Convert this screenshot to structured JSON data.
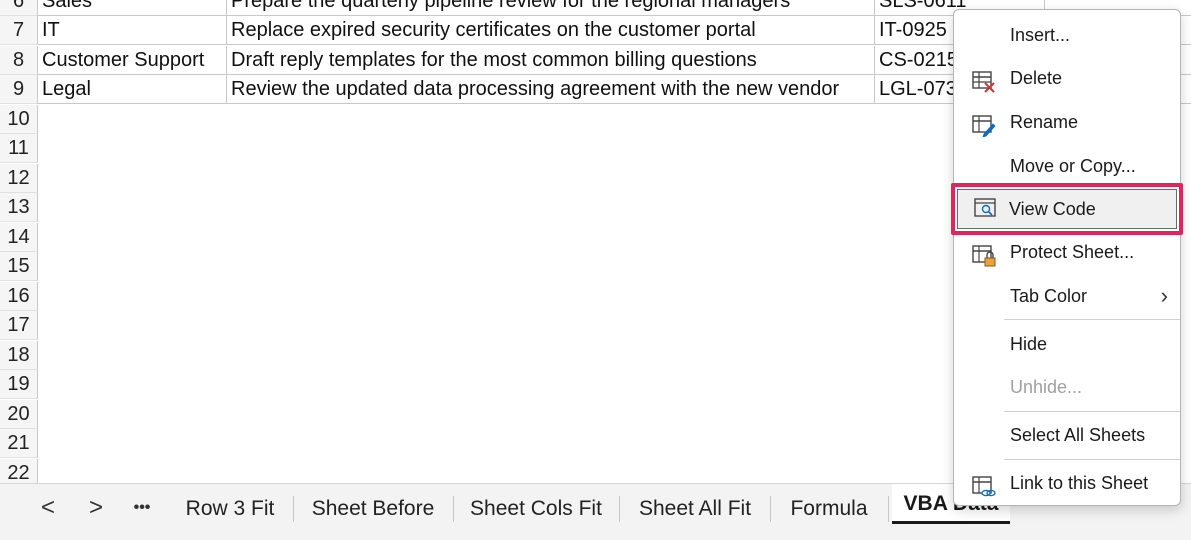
{
  "rows": [
    {
      "num": "6",
      "dept": "Sales",
      "task": "Prepare the quarterly pipeline review for the regional managers",
      "code": "SLS-0611"
    },
    {
      "num": "7",
      "dept": "IT",
      "task": "Replace expired security certificates on the customer portal",
      "code": "IT-0925"
    },
    {
      "num": "8",
      "dept": "Customer Support",
      "task": "Draft reply templates for the most common billing questions",
      "code": "CS-0215"
    },
    {
      "num": "9",
      "dept": "Legal",
      "task": "Review the updated data processing agreement with the new vendor",
      "code": "LGL-073"
    }
  ],
  "empty_rows": [
    "10",
    "11",
    "12",
    "13",
    "14",
    "15",
    "16",
    "17",
    "18",
    "19",
    "20",
    "21",
    "22"
  ],
  "tabbar": {
    "prev": "<",
    "next": ">",
    "more": "•••",
    "tabs": [
      "Row 3 Fit",
      "Sheet Before",
      "Sheet Cols Fit",
      "Sheet All Fit",
      "Formula",
      "VBA Data"
    ]
  },
  "menu": {
    "insert": "Insert...",
    "delete": "Delete",
    "rename": "Rename",
    "move_copy": "Move or Copy...",
    "view_code": "View Code",
    "protect": "Protect Sheet...",
    "tab_color": "Tab Color",
    "hide": "Hide",
    "unhide": "Unhide...",
    "select_all": "Select All Sheets",
    "link": "Link to this Sheet"
  },
  "colors": {
    "highlight": "#e0245e",
    "delete_x": "#d13438",
    "link_accent": "#0f6cbd"
  }
}
